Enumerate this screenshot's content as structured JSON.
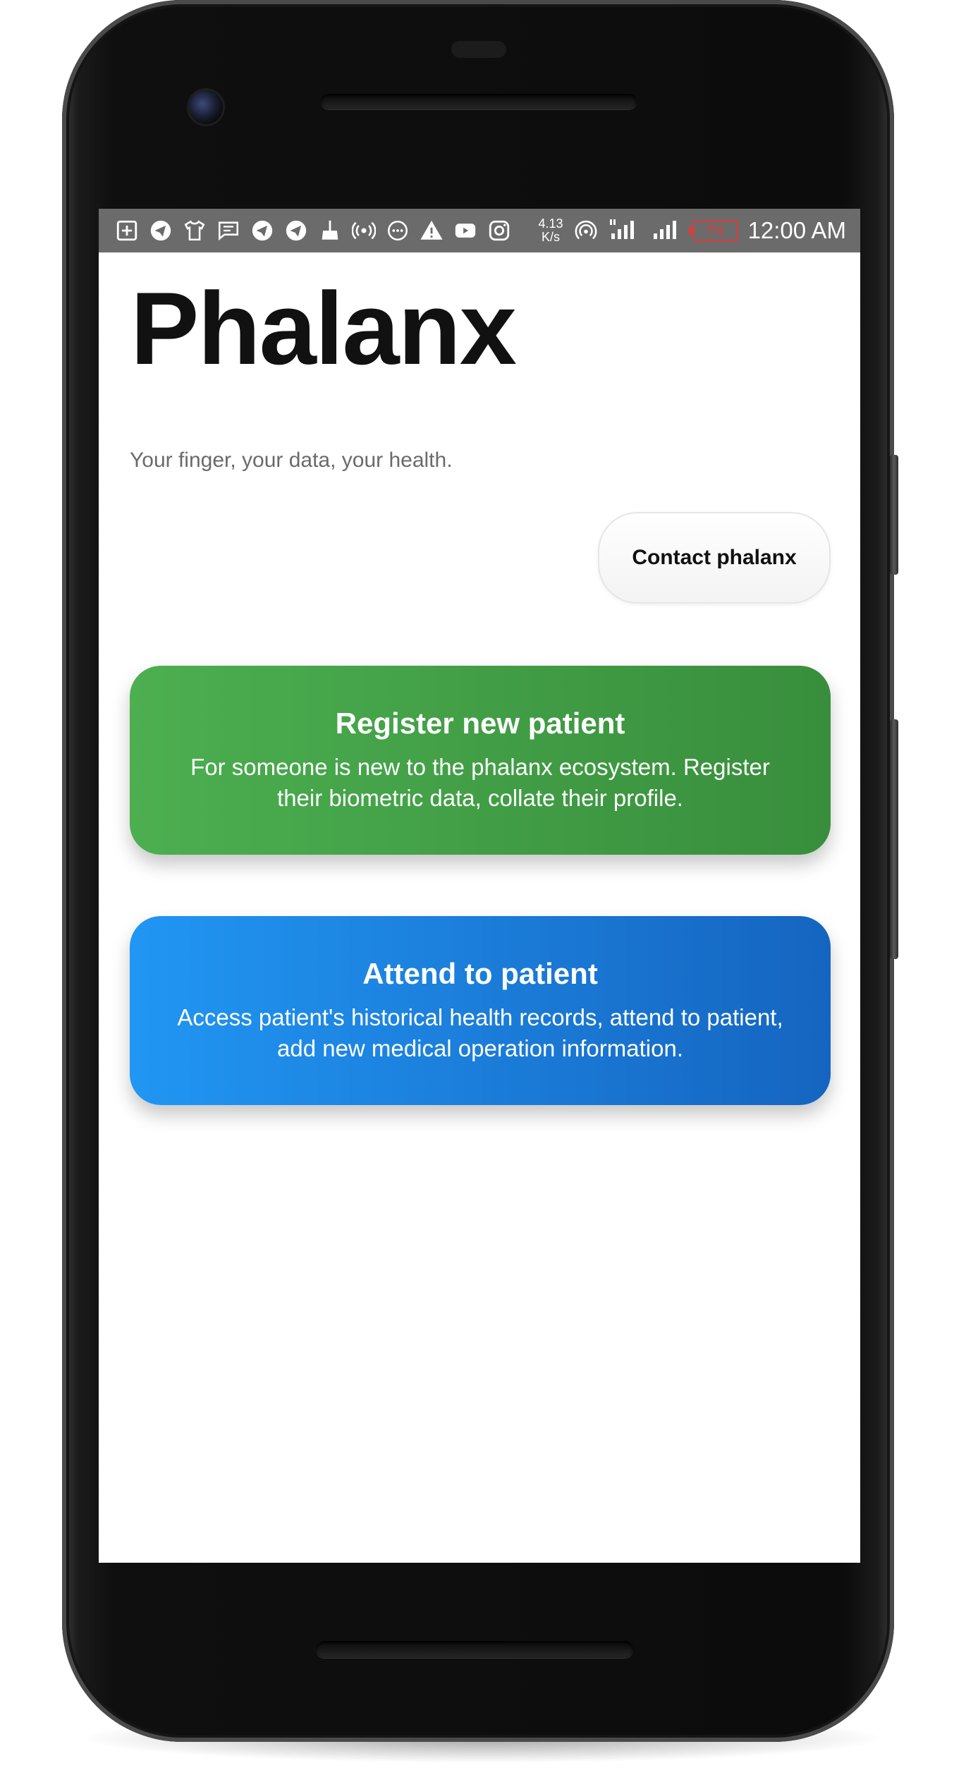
{
  "status_bar": {
    "notification_icons": [
      "plus-box-icon",
      "telegram-icon",
      "shirt-icon",
      "message-icon",
      "telegram-icon",
      "telegram-icon",
      "broom-icon",
      "broadcast-icon",
      "chat-bubble-icon",
      "warning-icon",
      "youtube-icon",
      "instagram-icon"
    ],
    "net_speed_value": "4.13",
    "net_speed_unit": "K/s",
    "battery_level": "7%",
    "time": "12:00 AM",
    "colors": {
      "bar": "#6b6b6b",
      "battery_low": "#e53935"
    }
  },
  "app": {
    "title": "Phalanx",
    "tagline": "Your finger, your data, your health.",
    "contact_button": "Contact phalanx"
  },
  "actions": [
    {
      "title": "Register new patient",
      "description": "For someone is new to the phalanx ecosystem. Register their biometric data, collate their profile.",
      "color": "#43a047"
    },
    {
      "title": "Attend to patient",
      "description": "Access patient's historical health records, attend to patient, add new medical operation information.",
      "color": "#1e88e5"
    }
  ]
}
